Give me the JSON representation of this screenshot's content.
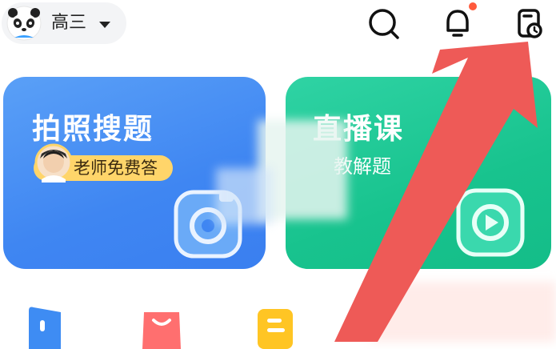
{
  "header": {
    "grade_label": "高三",
    "icons": [
      "search-icon",
      "bell-icon",
      "history-icon"
    ]
  },
  "cards": [
    {
      "title": "拍照搜题",
      "badge": "老师免费答",
      "icon": "camera-icon",
      "color": "#3f86f2"
    },
    {
      "title": "直播课",
      "subtitle": "教解题",
      "icon": "play-icon",
      "color": "#18c38e"
    }
  ],
  "bottom_nav": {
    "icons": [
      "blue-book-icon",
      "pink-bag-icon",
      "yellow-note-icon"
    ]
  }
}
